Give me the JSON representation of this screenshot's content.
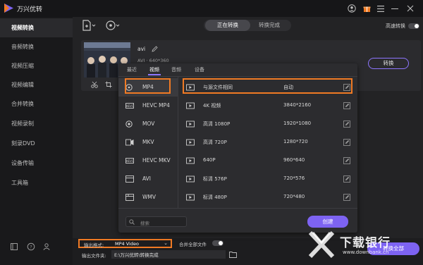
{
  "app": {
    "title": "万兴优转"
  },
  "sidebar": {
    "items": [
      {
        "label": "视频转换"
      },
      {
        "label": "音频转换"
      },
      {
        "label": "视频压缩"
      },
      {
        "label": "视频编辑"
      },
      {
        "label": "合并转换"
      },
      {
        "label": "视频录制"
      },
      {
        "label": "刻录DVD"
      },
      {
        "label": "设备传输"
      },
      {
        "label": "工具箱"
      }
    ]
  },
  "toolbar": {
    "tabs": [
      {
        "label": "正在转换"
      },
      {
        "label": "转换完成"
      }
    ],
    "high_speed_label": "高速转换"
  },
  "file": {
    "name": "avi",
    "meta": "AVI · 640*360",
    "convert_label": "转换"
  },
  "popup": {
    "tabs": [
      {
        "label": "最近"
      },
      {
        "label": "视频"
      },
      {
        "label": "音频"
      },
      {
        "label": "设备"
      }
    ],
    "formats": [
      {
        "label": "MP4",
        "icon": "mp4-icon"
      },
      {
        "label": "HEVC MP4",
        "icon": "hevc-icon"
      },
      {
        "label": "MOV",
        "icon": "mov-icon"
      },
      {
        "label": "MKV",
        "icon": "mkv-icon"
      },
      {
        "label": "HEVC MKV",
        "icon": "hevc-icon"
      },
      {
        "label": "AVI",
        "icon": "avi-icon"
      },
      {
        "label": "WMV",
        "icon": "wmv-icon"
      }
    ],
    "resolutions": [
      {
        "name": "与源文件相同",
        "value": "自动"
      },
      {
        "name": "4K 视频",
        "value": "3840*2160"
      },
      {
        "name": "高清 1080P",
        "value": "1920*1080"
      },
      {
        "name": "高清 720P",
        "value": "1280*720"
      },
      {
        "name": "640P",
        "value": "960*640"
      },
      {
        "name": "标清 576P",
        "value": "720*576"
      },
      {
        "name": "标清 480P",
        "value": "720*480"
      }
    ],
    "search_placeholder": "搜索",
    "create_label": "创建"
  },
  "bottom": {
    "output_format_label": "输出格式:",
    "output_format_value": "MP4 Video",
    "merge_label": "合并全部文件",
    "output_folder_label": "输出文件夹:",
    "output_folder_value": "E:\\万兴优转\\转换完成",
    "convert_all_label": "转换全部"
  },
  "watermark": {
    "text": "下载银行",
    "url": "www.downbank.cn"
  },
  "colors": {
    "accent": "#7d63f2",
    "highlight": "#f07a24"
  }
}
